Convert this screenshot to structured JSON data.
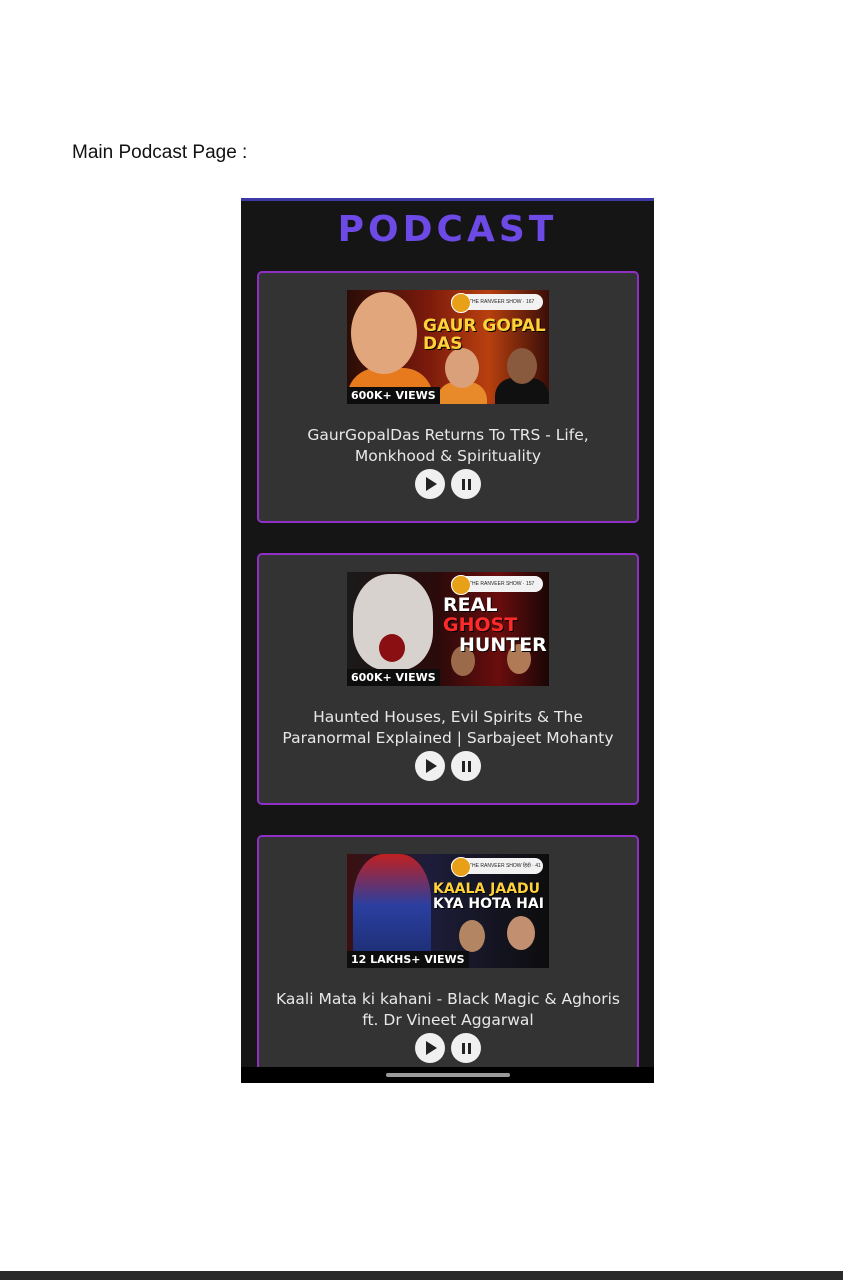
{
  "document": {
    "caption": "Main Podcast Page :"
  },
  "app": {
    "title": "PODCAST"
  },
  "colors": {
    "accent": "#6d49e6",
    "card_border": "#8f2fc3",
    "card_bg": "#333333",
    "screen_bg": "#151515"
  },
  "podcasts": [
    {
      "views": "600K+ VIEWS",
      "thumb_headline": "GAUR GOPAL DAS",
      "show_badge": "THE RANVEER SHOW · 167",
      "title": "GaurGopalDas Returns To TRS - Life, Monkhood & Spirituality",
      "play_icon": "play-icon",
      "pause_icon": "pause-icon"
    },
    {
      "views": "600K+ VIEWS",
      "thumb_headline_a": "REAL",
      "thumb_headline_b": "GHOST",
      "thumb_headline_c": "HUNTER",
      "show_badge": "THE RANVEER SHOW · 157",
      "title": "Haunted Houses, Evil Spirits & The Paranormal Explained | Sarbajeet Mohanty",
      "play_icon": "play-icon",
      "pause_icon": "pause-icon"
    },
    {
      "views": "12 LAKHS+ VIEWS",
      "thumb_headline_a": "KAALA JAADU",
      "thumb_headline_b": "KYA HOTA HAI",
      "show_badge": "THE RANVEER SHOW हिंदी · 41",
      "title": "Kaali Mata ki kahani - Black Magic & Aghoris ft. Dr Vineet Aggarwal",
      "play_icon": "play-icon",
      "pause_icon": "pause-icon"
    }
  ]
}
